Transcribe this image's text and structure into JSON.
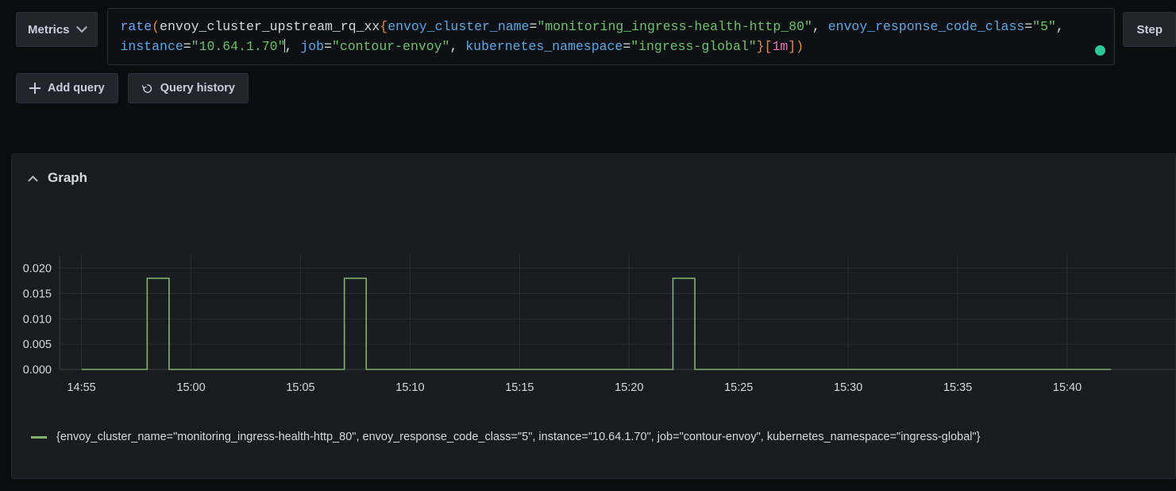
{
  "toolbar": {
    "metrics_label": "Metrics",
    "metrics_icon": "chevron-down-icon",
    "step_label": "Step",
    "status_icon": "status-dot-green",
    "status_color": "#2fc99a"
  },
  "query": {
    "full_text": "rate(envoy_cluster_upstream_rq_xx{envoy_cluster_name=\"monitoring_ingress-health-http_80\", envoy_response_code_class=\"5\", instance=\"10.64.1.70\", job=\"contour-envoy\", kubernetes_namespace=\"ingress-global\"}[1m])",
    "tokens": {
      "fn": "rate",
      "open_paren": "(",
      "metric": "envoy_cluster_upstream_rq_xx",
      "open_brace": "{",
      "label1": "envoy_cluster_name",
      "eq": "=",
      "value1": "\"monitoring_ingress-health-http_80\"",
      "comma": ", ",
      "label2": "envoy_response_code_class",
      "value2": "\"5\"",
      "label3": "instance",
      "value3": "\"10.64.1.70\"",
      "label4": "job",
      "value4": "\"contour-envoy\"",
      "label5": "kubernetes_namespace",
      "value5": "\"ingress-global\"",
      "close_brace": "}",
      "open_bracket": "[",
      "duration": "1m",
      "close_bracket": "]",
      "close_paren": ")"
    }
  },
  "actions": {
    "add_query_label": "Add query",
    "add_query_icon": "plus-icon",
    "query_history_label": "Query history",
    "query_history_icon": "history-icon"
  },
  "graph_panel": {
    "title": "Graph",
    "collapse_icon": "chevron-up-icon",
    "legend_series": "{envoy_cluster_name=\"monitoring_ingress-health-http_80\", envoy_response_code_class=\"5\", instance=\"10.64.1.70\", job=\"contour-envoy\", kubernetes_namespace=\"ingress-global\"}"
  },
  "chart_data": {
    "type": "line",
    "title": "Graph",
    "xlabel": "",
    "ylabel": "",
    "line_color": "#7eb26d",
    "grid": true,
    "legend_position": "bottom",
    "x_tick_labels": [
      "14:55",
      "15:00",
      "15:05",
      "15:10",
      "15:15",
      "15:20",
      "15:25",
      "15:30",
      "15:35",
      "15:40"
    ],
    "y_tick_labels": [
      "0.000",
      "0.005",
      "0.010",
      "0.015",
      "0.020"
    ],
    "ylim": [
      0.0,
      0.0215
    ],
    "xlim_minutes": [
      894,
      945
    ],
    "series": [
      {
        "name": "{envoy_cluster_name=\"monitoring_ingress-health-http_80\", envoy_response_code_class=\"5\", instance=\"10.64.1.70\", job=\"contour-envoy\", kubernetes_namespace=\"ingress-global\"}",
        "color": "#7eb26d",
        "points": [
          {
            "t": "14:55",
            "v": 0.0
          },
          {
            "t": "14:58",
            "v": 0.0
          },
          {
            "t": "14:58",
            "v": 0.018
          },
          {
            "t": "14:59",
            "v": 0.018
          },
          {
            "t": "14:59",
            "v": 0.0
          },
          {
            "t": "15:07",
            "v": 0.0
          },
          {
            "t": "15:07",
            "v": 0.018
          },
          {
            "t": "15:08",
            "v": 0.018
          },
          {
            "t": "15:08",
            "v": 0.0
          },
          {
            "t": "15:22",
            "v": 0.0
          },
          {
            "t": "15:22",
            "v": 0.018
          },
          {
            "t": "15:23",
            "v": 0.018
          },
          {
            "t": "15:23",
            "v": 0.0
          },
          {
            "t": "15:42",
            "v": 0.0
          }
        ],
        "pulses": [
          {
            "start": "14:58",
            "end": "14:59",
            "peak": 0.018
          },
          {
            "start": "15:07",
            "end": "15:08",
            "peak": 0.018
          },
          {
            "start": "15:22",
            "end": "15:23",
            "peak": 0.018
          }
        ]
      }
    ]
  }
}
